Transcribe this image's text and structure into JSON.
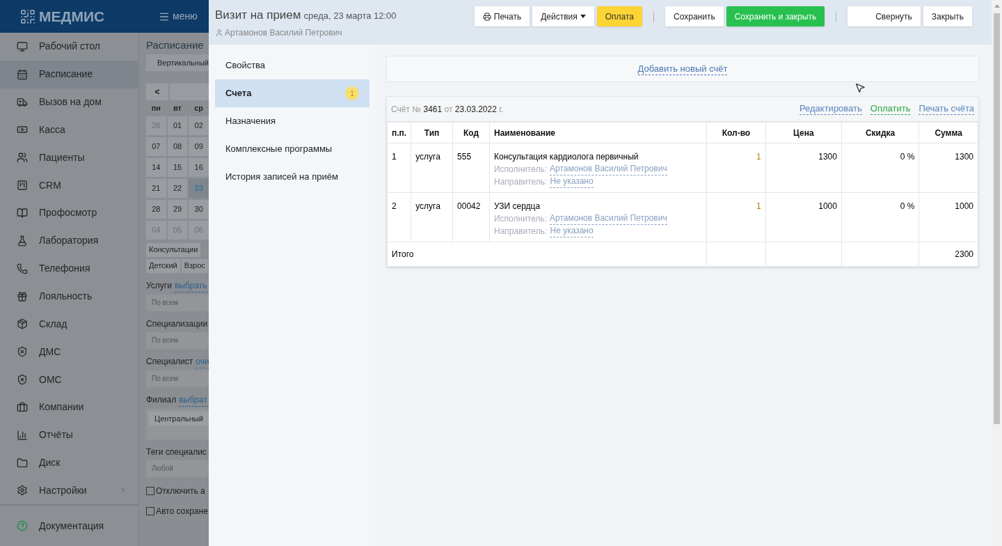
{
  "app": {
    "logo": "МЕДМИС",
    "menu_button": "меню"
  },
  "sidebar": {
    "items": [
      {
        "label": "Рабочий стол",
        "selected": false,
        "has_submenu": false
      },
      {
        "label": "Расписание",
        "selected": true,
        "has_submenu": false
      },
      {
        "label": "Вызов на дом",
        "selected": false,
        "has_submenu": false
      },
      {
        "label": "Касса",
        "selected": false,
        "has_submenu": false
      },
      {
        "label": "Пациенты",
        "selected": false,
        "has_submenu": false
      },
      {
        "label": "CRM",
        "selected": false,
        "has_submenu": false
      },
      {
        "label": "Профосмотр",
        "selected": false,
        "has_submenu": false
      },
      {
        "label": "Лаборатория",
        "selected": false,
        "has_submenu": false
      },
      {
        "label": "Телефония",
        "selected": false,
        "has_submenu": false
      },
      {
        "label": "Лояльность",
        "selected": false,
        "has_submenu": false
      },
      {
        "label": "Склад",
        "selected": false,
        "has_submenu": false
      },
      {
        "label": "ДМС",
        "selected": false,
        "has_submenu": false
      },
      {
        "label": "ОМС",
        "selected": false,
        "has_submenu": false
      },
      {
        "label": "Компании",
        "selected": false,
        "has_submenu": false
      },
      {
        "label": "Отчёты",
        "selected": false,
        "has_submenu": false
      },
      {
        "label": "Диск",
        "selected": false,
        "has_submenu": false
      },
      {
        "label": "Настройки",
        "selected": false,
        "has_submenu": true
      }
    ],
    "footer_item": "Документация"
  },
  "schedule": {
    "title": "Расписание",
    "view_button": "Вертикальный",
    "prev_button": "<",
    "weekdays": [
      "пн",
      "вт",
      "ср"
    ],
    "weeks": [
      [
        {
          "d": "28",
          "other_month": true,
          "today": false
        },
        {
          "d": "01",
          "other_month": false,
          "today": false
        },
        {
          "d": "02",
          "other_month": false,
          "today": false
        }
      ],
      [
        {
          "d": "07",
          "other_month": false,
          "today": false
        },
        {
          "d": "08",
          "other_month": false,
          "today": false
        },
        {
          "d": "09",
          "other_month": false,
          "today": false
        }
      ],
      [
        {
          "d": "14",
          "other_month": false,
          "today": false
        },
        {
          "d": "15",
          "other_month": false,
          "today": false
        },
        {
          "d": "16",
          "other_month": false,
          "today": false
        }
      ],
      [
        {
          "d": "21",
          "other_month": false,
          "today": false
        },
        {
          "d": "22",
          "other_month": false,
          "today": false
        },
        {
          "d": "23",
          "other_month": false,
          "today": true
        }
      ],
      [
        {
          "d": "28",
          "other_month": false,
          "today": false
        },
        {
          "d": "29",
          "other_month": false,
          "today": false
        },
        {
          "d": "30",
          "other_month": false,
          "today": false
        }
      ],
      [
        {
          "d": "04",
          "other_month": true,
          "today": false
        },
        {
          "d": "05",
          "other_month": true,
          "today": false
        },
        {
          "d": "06",
          "other_month": true,
          "today": false
        }
      ]
    ],
    "type_tabs": [
      "Консультации"
    ],
    "age_tabs": [
      "Детский",
      "Взрос"
    ],
    "filters": [
      {
        "label": "Услуги",
        "link": "выбрать",
        "placeholder": "По всем"
      },
      {
        "label": "Специализации",
        "placeholder": "По всем"
      },
      {
        "label": "Специалист",
        "link": "очи",
        "placeholder": "По всем"
      },
      {
        "label": "Филиал",
        "link": "выбрат",
        "value": "Центральный"
      },
      {
        "label": "Теги специалис",
        "placeholder": "Любой"
      }
    ],
    "checkboxes": [
      {
        "label": "Отключить а",
        "checked": false
      },
      {
        "label": "Авто сохране",
        "checked": false
      }
    ]
  },
  "modal": {
    "title": "Визит на прием",
    "datetime": "среда, 23 марта 12:00",
    "patient": "Артамонов Василий Петрович",
    "button_groups": [
      [
        {
          "label": "Печать",
          "kind": "print"
        },
        {
          "label": "Действия",
          "kind": "dropdown"
        },
        {
          "label": "Оплата",
          "kind": "warning"
        }
      ],
      [
        {
          "label": "Сохранить",
          "kind": "default"
        },
        {
          "label": "Сохранить и закрыть",
          "kind": "success"
        }
      ],
      [
        {
          "label": "Свернуть",
          "kind": "wide"
        },
        {
          "label": "Закрыть",
          "kind": "default"
        }
      ]
    ],
    "nav": [
      {
        "label": "Свойства",
        "selected": false
      },
      {
        "label": "Счета",
        "selected": true,
        "badge": "1"
      },
      {
        "label": "Назначения",
        "selected": false
      },
      {
        "label": "Комплексные программы",
        "selected": false
      },
      {
        "label": "История записей на приём",
        "selected": false
      }
    ],
    "add_invoice": "Добавить новый счёт",
    "invoice": {
      "number_prefix": "Счёт №",
      "number": "3461",
      "date_prefix": "от",
      "date": "23.03.2022",
      "date_suffix": "г.",
      "actions": [
        {
          "label": "Редактировать",
          "kind": "link"
        },
        {
          "label": "Оплатить",
          "kind": "pay"
        },
        {
          "label": "Печать счёта",
          "kind": "link"
        }
      ],
      "columns": [
        "п.п.",
        "Тип",
        "Код",
        "Наименование",
        "Кол-во",
        "Цена",
        "Скидка",
        "Сумма"
      ],
      "rows": [
        {
          "n": "1",
          "type": "услуга",
          "code": "555",
          "name": "Консультация кардиолога первичный",
          "performer_label": "Исполнитель:",
          "performer": "Артамонов Василий Петрович",
          "referrer_label": "Направитель:",
          "referrer": "Не указано",
          "qty": "1",
          "price": "1300",
          "discount": "0 %",
          "sum": "1300"
        },
        {
          "n": "2",
          "type": "услуга",
          "code": "00042",
          "name": "УЗИ сердца",
          "performer_label": "Исполнитель:",
          "performer": "Артамонов Василий Петрович",
          "referrer_label": "Направитель:",
          "referrer": "Не указано",
          "qty": "1",
          "price": "1000",
          "discount": "0 %",
          "sum": "1000"
        }
      ],
      "total_label": "Итого",
      "total": "2300"
    }
  }
}
